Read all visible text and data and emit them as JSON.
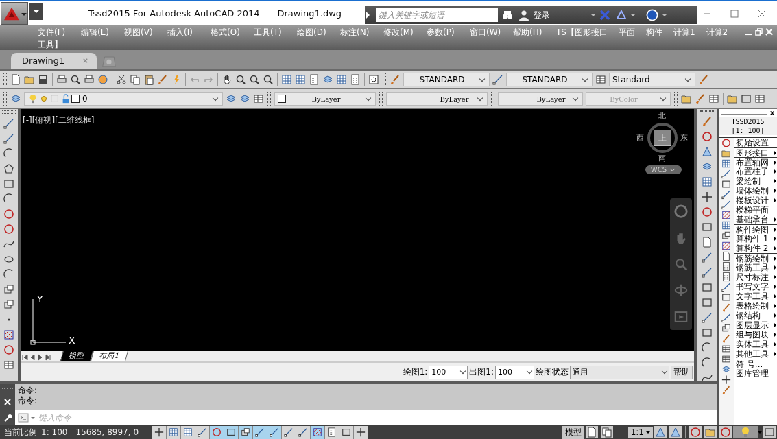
{
  "title_bar": {
    "app_title": "Tssd2015 For Autodesk AutoCAD 2014",
    "document": "Drawing1.dwg",
    "search": {
      "placeholder": "鍵入关键字或短语"
    },
    "sign_in": "登录"
  },
  "menu_bar": {
    "rows": [
      [
        "文件(F)",
        "编辑(E)",
        "视图(V)",
        "插入(I)",
        "格式(O)",
        "工具(T)",
        "绘图(D)",
        "标注(N)",
        "修改(M)",
        "参数(P)",
        "窗口(W)",
        "帮助(H)",
        "TS【图形接口",
        "平面",
        "构件",
        "计算1",
        "计算2"
      ],
      [
        "工具】"
      ]
    ]
  },
  "doc_tabs": [
    {
      "label": "Drawing1",
      "selected": true
    }
  ],
  "styles_toolbar": {
    "text_style": "STANDARD",
    "dim_style": "STANDARD",
    "table_style": "Standard"
  },
  "properties_toolbar": {
    "layer": "0",
    "color_setting": "ByLayer",
    "linetype": "ByLayer",
    "lineweight": "ByLayer",
    "plot_style": {
      "value": "ByColor",
      "disabled": true
    }
  },
  "viewport": {
    "label": "[-][俯视][二维线框]",
    "viewcube": {
      "north": "北",
      "south": "南",
      "east": "东",
      "west": "西",
      "top": "上"
    },
    "wcs": "WCS",
    "ucs": {
      "x": "X",
      "y": "Y"
    }
  },
  "layout_tabs": [
    {
      "label": "模型",
      "selected": true
    },
    {
      "label": "布局1",
      "selected": false
    }
  ],
  "scale_bar": {
    "draw_label": "绘图1:",
    "draw_value": "100",
    "plot_label": "出图1:",
    "plot_value": "100",
    "state_label": "绘图状态",
    "state_value": "通用",
    "help": "帮助"
  },
  "tssd_panel": {
    "title": "TSSD2015",
    "scale": "[1: 100]",
    "items": [
      {
        "label": "初始设置",
        "submenu": false,
        "group_start": false
      },
      {
        "label": "图形接口",
        "submenu": true,
        "group_start": true
      },
      {
        "label": "布置轴网",
        "submenu": true,
        "group_start": true
      },
      {
        "label": "布置柱子",
        "submenu": true,
        "group_start": false
      },
      {
        "label": "梁绘制",
        "submenu": true,
        "group_start": false
      },
      {
        "label": "墙体绘制",
        "submenu": true,
        "group_start": false
      },
      {
        "label": "楼板设计",
        "submenu": true,
        "group_start": false
      },
      {
        "label": "楼梯平面",
        "submenu": false,
        "group_start": false
      },
      {
        "label": "基础承台",
        "submenu": true,
        "group_start": false
      },
      {
        "label": "构件绘图",
        "submenu": true,
        "group_start": true
      },
      {
        "label": "算构件 1",
        "submenu": true,
        "group_start": false
      },
      {
        "label": "算构件 2",
        "submenu": true,
        "group_start": false
      },
      {
        "label": "钢筋绘制",
        "submenu": true,
        "group_start": true
      },
      {
        "label": "钢筋工具",
        "submenu": true,
        "group_start": false
      },
      {
        "label": "尺寸标注",
        "submenu": true,
        "group_start": false
      },
      {
        "label": "书写文字",
        "submenu": true,
        "group_start": false
      },
      {
        "label": "文字工具",
        "submenu": true,
        "group_start": false
      },
      {
        "label": "表格绘制",
        "submenu": true,
        "group_start": false
      },
      {
        "label": "钢结构",
        "submenu": true,
        "group_start": false
      },
      {
        "label": "图层显示",
        "submenu": true,
        "group_start": false
      },
      {
        "label": "组与图块",
        "submenu": true,
        "group_start": false
      },
      {
        "label": "实体工具",
        "submenu": true,
        "group_start": false
      },
      {
        "label": "其他工具",
        "submenu": true,
        "group_start": false
      },
      {
        "label": "符 号...",
        "submenu": false,
        "group_start": true
      },
      {
        "label": "图库管理",
        "submenu": false,
        "group_start": false
      }
    ]
  },
  "command_line": {
    "history": [
      "命令:",
      "命令:"
    ],
    "placeholder": "键入命令"
  },
  "status_bar": {
    "scale_label": "当前比例",
    "scale": "1: 100",
    "coords": "15685, 8997, 0",
    "toggles": [
      {
        "on": false
      },
      {
        "on": false
      },
      {
        "on": false
      },
      {
        "on": false
      },
      {
        "on": true
      },
      {
        "on": true
      },
      {
        "on": true
      },
      {
        "on": true
      },
      {
        "on": true
      },
      {
        "on": false
      },
      {
        "on": false
      },
      {
        "on": true
      },
      {
        "on": false
      },
      {
        "on": false
      },
      {
        "on": false
      }
    ],
    "model": "模型",
    "annotation_scale": "1:1"
  }
}
